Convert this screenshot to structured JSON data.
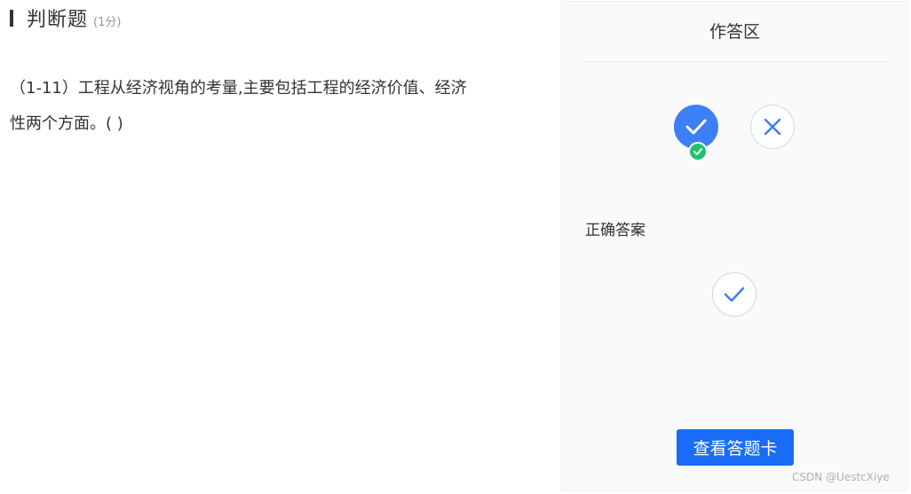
{
  "question": {
    "type_title": "判断题",
    "score": "(1分)",
    "text_line1": "（1-11）工程从经济视角的考量,主要包括工程的经济价值、经济",
    "text_line2": "性两个方面。(   )"
  },
  "panel": {
    "title": "作答区",
    "options": [
      {
        "icon": "check-icon",
        "selected": true
      },
      {
        "icon": "close-icon",
        "selected": false
      }
    ],
    "correct_label": "正确答案",
    "correct_icon": "check-icon",
    "answer_card_label": "查看答题卡"
  },
  "watermark": "CSDN @UestcXiye",
  "colors": {
    "accent": "#1a6cf6",
    "selected_fill": "#3d7ff5",
    "selected_badge": "#1cc46b",
    "option_border": "#c5d8f5"
  }
}
